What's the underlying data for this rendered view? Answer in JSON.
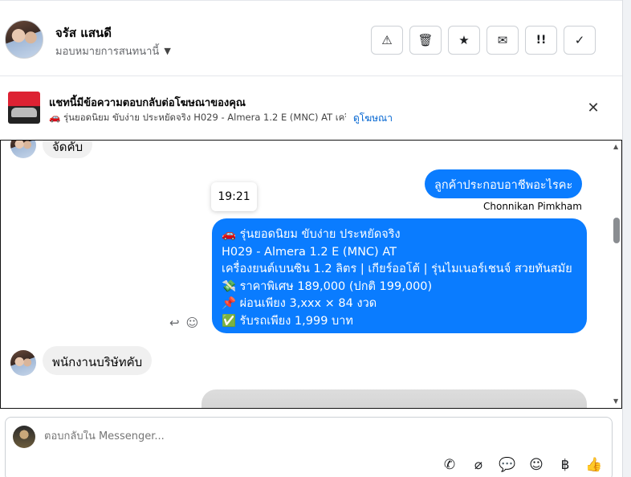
{
  "header": {
    "contact_name": "จรัส แสนดี",
    "assign_label": "มอบหมายการสนทนานี้",
    "actions": [
      {
        "icon": "warning-icon",
        "glyph": "⚠"
      },
      {
        "icon": "trash-icon",
        "glyph": "🗑"
      },
      {
        "icon": "star-icon",
        "glyph": "★"
      },
      {
        "icon": "envelope-icon",
        "glyph": "✉"
      },
      {
        "icon": "follow-up-icon",
        "glyph": "!!"
      },
      {
        "icon": "check-icon",
        "glyph": "✓"
      }
    ]
  },
  "ad_notice": {
    "title": "แชทนี้มีข้อความตอบกลับต่อโฆษณาของคุณ",
    "subtitle": "🚗 รุ่นยอดนิยม ขับง่าย ประหยัดจริง H029 - Almera 1.2 E (MNC) AT เครื่...",
    "link": "ดูโฆษณา",
    "close_glyph": "✕"
  },
  "chat": {
    "messages": {
      "partial_incoming": "จัดคับ",
      "outgoing_short": "ลูกค้าประกอบอาชีพอะไรคะ",
      "timestamp": "19:21",
      "sender_name": "Chonnikan Pimkham",
      "ad_lines": [
        "🚗 รุ่นยอดนิยม ขับง่าย ประหยัดจริง",
        "H029 - Almera 1.2 E (MNC) AT",
        "เครื่องยนต์เบนซิน 1.2 ลิตร | เกียร์ออโต้ | รุ่นไมเนอร์เชนจ์ สวยทันสมัย",
        "💸 ราคาพิเศษ 189,000 (ปกติ 199,000)",
        "📌 ผ่อนเพียง 3,xxx × 84 งวด",
        "✅ รับรถเพียง 1,999 บาท"
      ],
      "incoming_reply": "พนักงานบริษัทคับ"
    }
  },
  "composer": {
    "placeholder": "ตอบกลับใน Messenger...",
    "tools": [
      {
        "icon": "phone-add-icon",
        "glyph": "✆"
      },
      {
        "icon": "attach-icon",
        "glyph": "⌀"
      },
      {
        "icon": "saved-replies-icon",
        "glyph": "💬"
      },
      {
        "icon": "emoji-icon",
        "glyph": "☺"
      },
      {
        "icon": "baht-icon",
        "glyph": "฿"
      },
      {
        "icon": "thumbs-up-icon",
        "glyph": "👍"
      }
    ]
  }
}
